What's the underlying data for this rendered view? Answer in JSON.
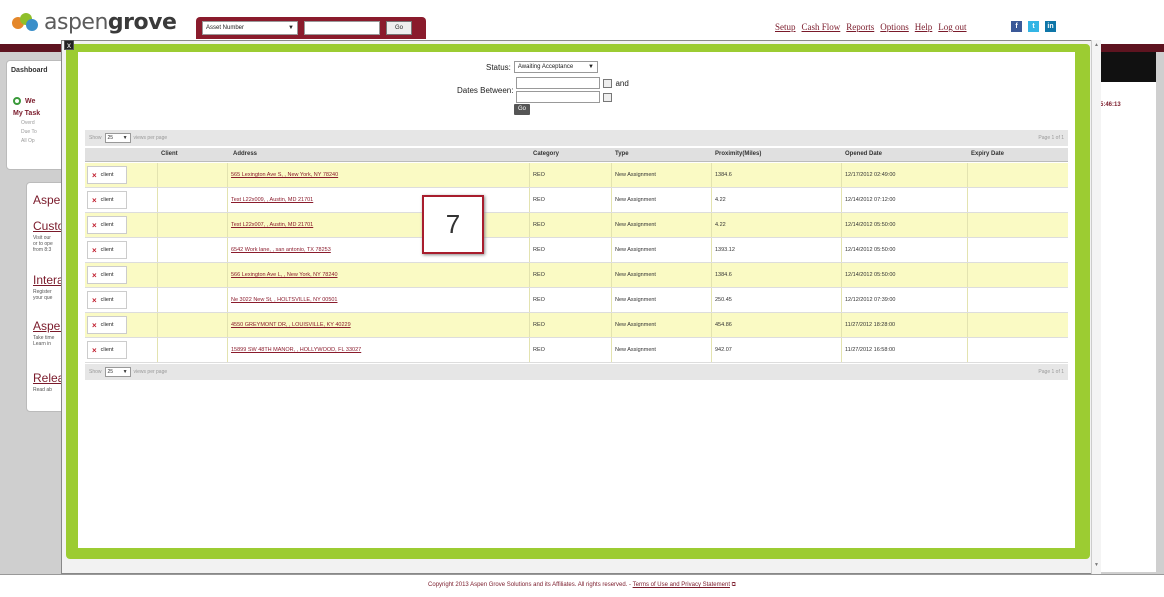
{
  "header": {
    "logo_prefix": "aspen",
    "logo_bold": "grove",
    "search_select": "Asset Number",
    "search_go": "Go",
    "nav": [
      "Setup",
      "Cash Flow",
      "Reports",
      "Options",
      "Help",
      "Log out"
    ],
    "social": [
      {
        "name": "facebook",
        "glyph": "f",
        "color": "#3b5998"
      },
      {
        "name": "twitter",
        "glyph": "t",
        "color": "#33b5e5"
      },
      {
        "name": "linkedin",
        "glyph": "in",
        "color": "#0e76a8"
      }
    ]
  },
  "background": {
    "tab": "Dashboard",
    "left_snippets": [
      "We",
      "My Task",
      "Overd",
      "Due To",
      "All Op",
      "Asper",
      "Custo",
      "Visit our",
      "or to ope",
      "from 8:3",
      "Intera",
      "Register",
      "your que",
      "Asper",
      "Take time",
      "Learn in",
      "Relea",
      "Read ab"
    ],
    "time": "5:46:13"
  },
  "modal": {
    "close_label": "x",
    "status_label": "Status:",
    "status_value": "Awaiting Acceptance",
    "dates_label": "Dates Between:",
    "and_label": "and",
    "go_label": "Go",
    "show_label": "Show",
    "per_page_value": "25",
    "per_page_suffix": "views per page",
    "page_of": "Page 1 of 1",
    "columns": [
      "Client",
      "Address",
      "Category",
      "Type",
      "Proximity(Miles)",
      "Opened Date",
      "Expiry Date"
    ],
    "rows": [
      {
        "client": "client",
        "address": "565 Lexington Ave S, , New York, NY 78240",
        "category": "REO",
        "type": "New Assignment",
        "proximity": "1384.6",
        "opened": "12/17/2012 02:49:00",
        "expiry": ""
      },
      {
        "client": "client",
        "address": "Test L22x009, , Austin, MD 21701",
        "category": "REO",
        "type": "New Assignment",
        "proximity": "4.22",
        "opened": "12/14/2012 07:12:00",
        "expiry": ""
      },
      {
        "client": "client",
        "address": "Test L22x007, , Austin, MD 21701",
        "category": "REO",
        "type": "New Assignment",
        "proximity": "4.22",
        "opened": "12/14/2012 05:50:00",
        "expiry": ""
      },
      {
        "client": "client",
        "address": "6542 Work lane, , san antonio, TX 78253",
        "category": "REO",
        "type": "New Assignment",
        "proximity": "1393.12",
        "opened": "12/14/2012 05:50:00",
        "expiry": ""
      },
      {
        "client": "client",
        "address": "566 Lexington Ave L, , New York, NY 78240",
        "category": "REO",
        "type": "New Assignment",
        "proximity": "1384.6",
        "opened": "12/14/2012 05:50:00",
        "expiry": ""
      },
      {
        "client": "client",
        "address": "Ne 3022 New St, , HOLTSVILLE, NY 00501",
        "category": "REO",
        "type": "New Assignment",
        "proximity": "250.45",
        "opened": "12/12/2012 07:39:00",
        "expiry": ""
      },
      {
        "client": "client",
        "address": "4550 GREYMONT DR, , LOUISVILLE, KY 40229",
        "category": "REO",
        "type": "New Assignment",
        "proximity": "454.86",
        "opened": "11/27/2012 18:28:00",
        "expiry": ""
      },
      {
        "client": "client",
        "address": "15899 SW 48TH MANOR, , HOLLYWOOD, FL 33027",
        "category": "REO",
        "type": "New Assignment",
        "proximity": "942.07",
        "opened": "11/27/2012 16:58:00",
        "expiry": ""
      }
    ]
  },
  "callout": "7",
  "footer": {
    "text": "Copyright 2013 Aspen Grove Solutions and its Affiliates. All rights reserved. - ",
    "link": "Terms of Use and Privacy Statement"
  }
}
